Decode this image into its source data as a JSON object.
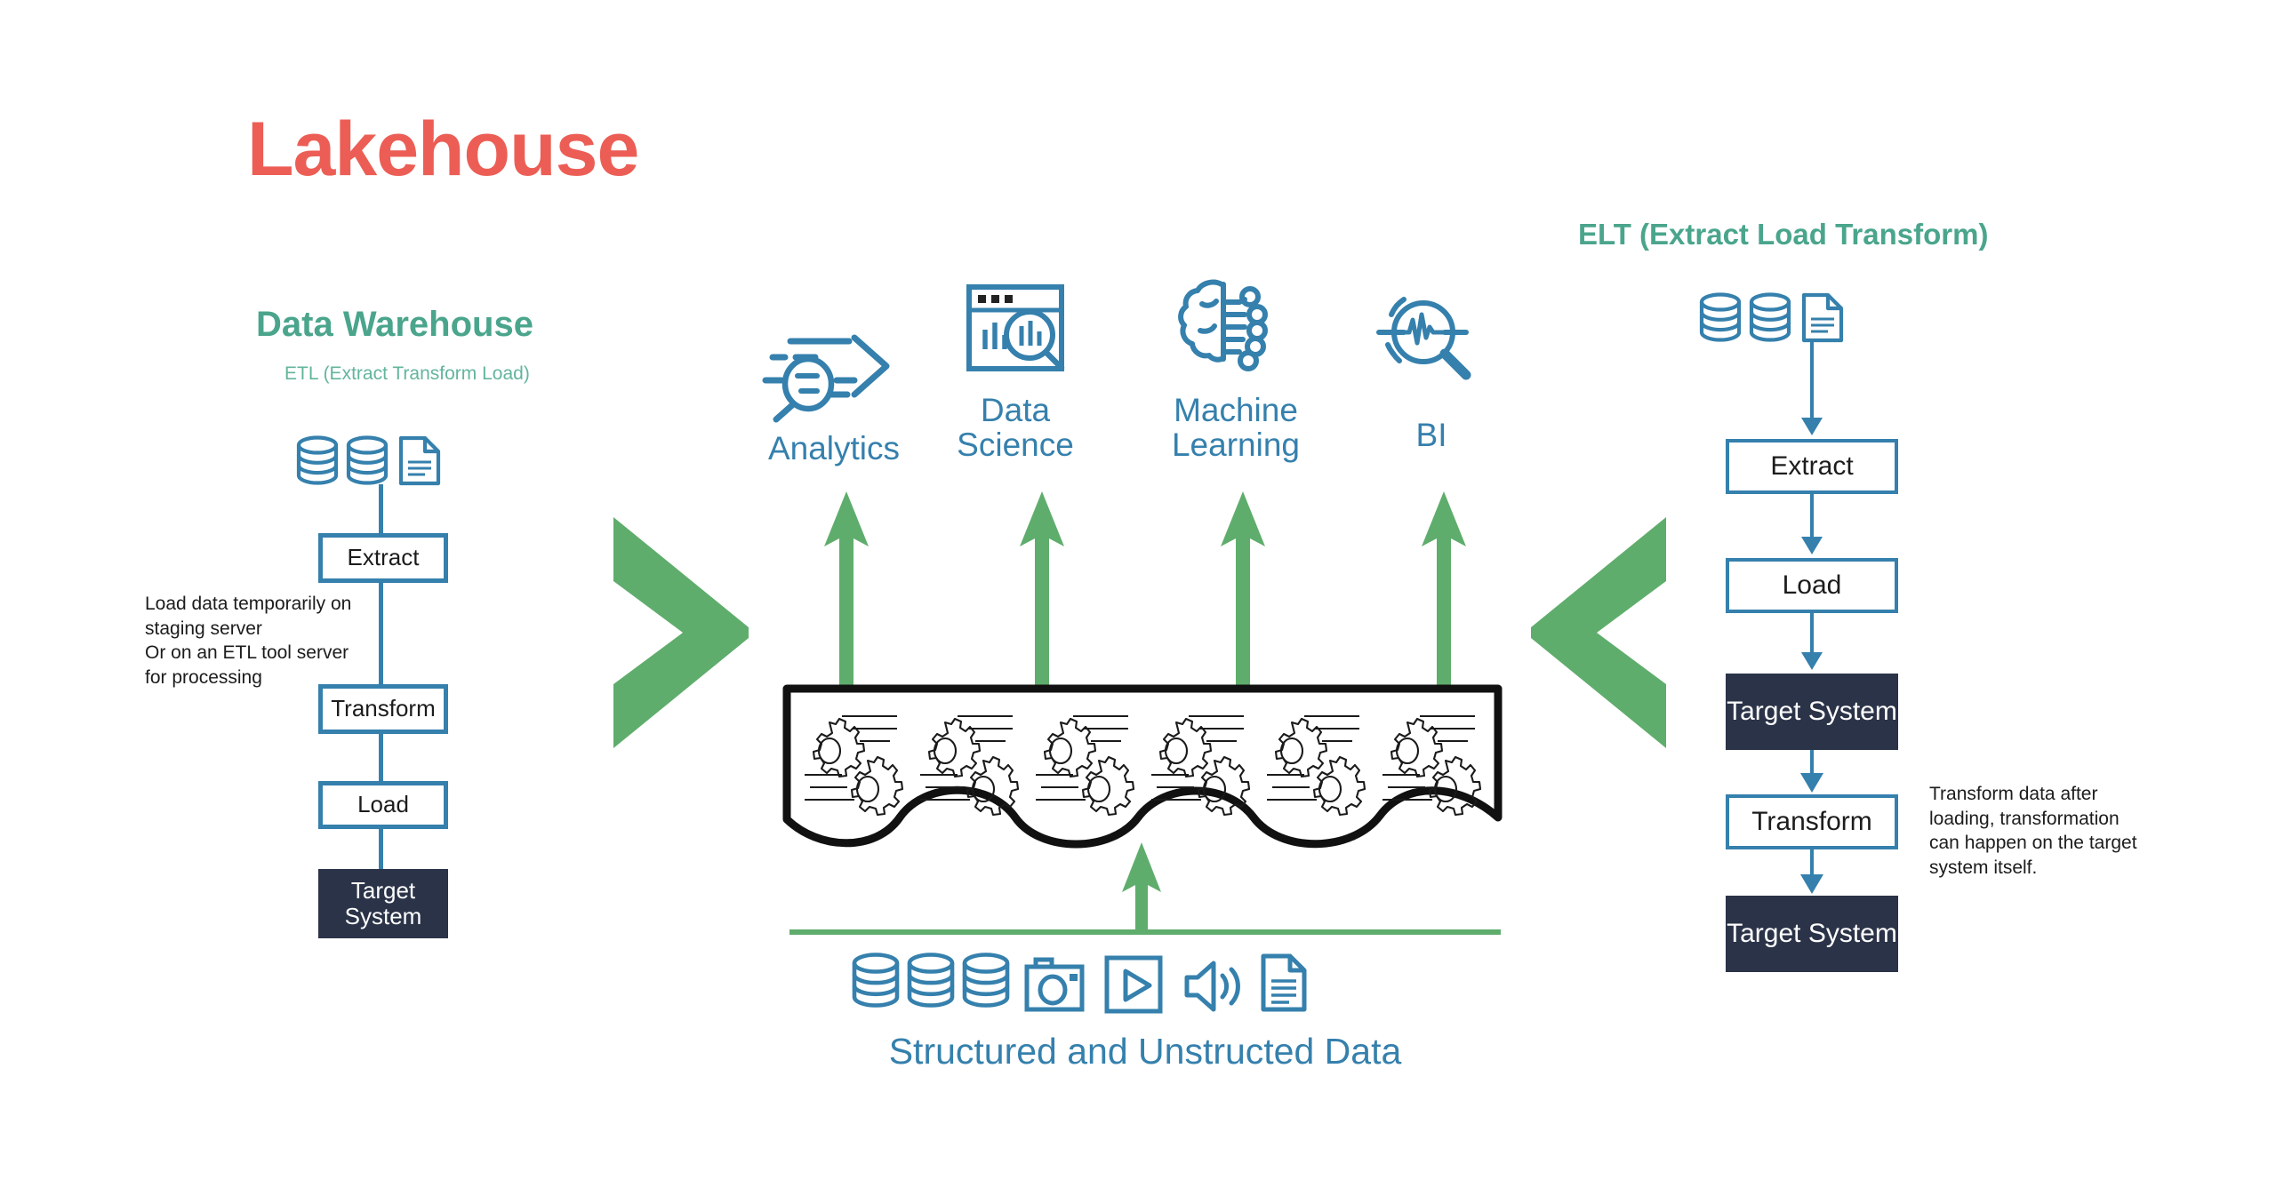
{
  "title": "Lakehouse",
  "left": {
    "heading": "Data Warehouse",
    "subheading": "ETL (Extract Transform Load)",
    "steps": [
      {
        "label": "Extract",
        "style": "outline"
      },
      {
        "label": "Transform",
        "style": "outline"
      },
      {
        "label": "Load",
        "style": "outline"
      },
      {
        "label": "Target\nSystem",
        "style": "dark"
      }
    ],
    "note": "Load data temporarily on\nstaging server\nOr on an ETL tool server\nfor processing",
    "source_icons": [
      "database-icon",
      "database-icon",
      "document-icon"
    ]
  },
  "right": {
    "heading": "ELT (Extract Load Transform)",
    "steps": [
      {
        "label": "Extract",
        "style": "outline"
      },
      {
        "label": "Load",
        "style": "outline"
      },
      {
        "label": "Target\nSystem",
        "style": "dark"
      },
      {
        "label": "Transform",
        "style": "outline"
      },
      {
        "label": "Target\nSystem",
        "style": "dark"
      }
    ],
    "note": "Transform data after\nloading, transformation\ncan happen on the target\nsystem itself.",
    "source_icons": [
      "database-icon",
      "database-icon",
      "document-icon"
    ]
  },
  "center": {
    "consumers": [
      {
        "label": "Analytics",
        "icon": "analytics-arrow-icon"
      },
      {
        "label": "Data\nScience",
        "icon": "data-science-window-icon"
      },
      {
        "label": "Machine\nLearning",
        "icon": "brain-network-icon"
      },
      {
        "label": "BI",
        "icon": "pulse-magnifier-icon"
      }
    ],
    "lake_gear_count": 6,
    "source_icons": [
      "database-icon",
      "database-icon",
      "database-icon",
      "camera-icon",
      "video-icon",
      "audio-icon",
      "document-icon"
    ],
    "bottom_caption": "Structured and Unstructed Data"
  },
  "colors": {
    "red": "#EC5E55",
    "green_title": "#4AA58C",
    "green_arrow": "#5FAD6C",
    "blue": "#3580AD",
    "navy": "#2B3348",
    "black": "#111111"
  }
}
